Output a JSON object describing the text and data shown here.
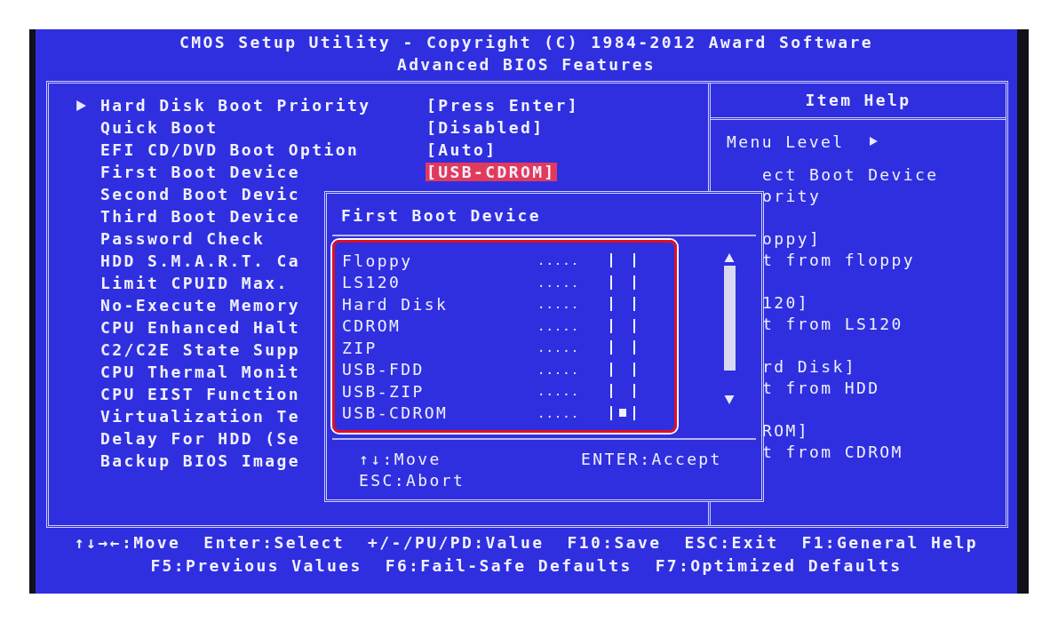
{
  "header": {
    "title": "CMOS Setup Utility - Copyright (C) 1984-2012 Award Software",
    "subtitle": "Advanced BIOS Features"
  },
  "items": [
    {
      "label": "Hard Disk Boot Priority",
      "submenu": true,
      "value": "[Press Enter]",
      "selected": false
    },
    {
      "label": "Quick Boot",
      "submenu": false,
      "value": "[Disabled]",
      "selected": false
    },
    {
      "label": "EFI CD/DVD Boot Option",
      "submenu": false,
      "value": "[Auto]",
      "selected": false
    },
    {
      "label": "First Boot Device",
      "submenu": false,
      "value": "[USB-CDROM]",
      "selected": true
    },
    {
      "label": "Second Boot Devic",
      "submenu": false,
      "selected": false
    },
    {
      "label": "Third Boot Device",
      "submenu": false,
      "selected": false
    },
    {
      "label": "Password Check",
      "submenu": false,
      "selected": false
    },
    {
      "label": "HDD S.M.A.R.T. Ca",
      "submenu": false,
      "selected": false
    },
    {
      "label": "Limit CPUID Max.",
      "submenu": false,
      "selected": false
    },
    {
      "label": "No-Execute Memory",
      "submenu": false,
      "selected": false
    },
    {
      "label": "CPU Enhanced Halt",
      "submenu": false,
      "selected": false
    },
    {
      "label": "C2/C2E State Supp",
      "submenu": false,
      "selected": false
    },
    {
      "label": "CPU Thermal Monit",
      "submenu": false,
      "selected": false
    },
    {
      "label": "CPU EIST Function",
      "submenu": false,
      "selected": false
    },
    {
      "label": "Virtualization Te",
      "submenu": false,
      "selected": false
    },
    {
      "label": "Delay For HDD (Se",
      "submenu": false,
      "selected": false
    },
    {
      "label": "Backup BIOS Image",
      "submenu": false,
      "selected": false
    }
  ],
  "help": {
    "title": "Item Help",
    "menu_level": "Menu Level",
    "blocks": [
      [
        "ect Boot Device",
        "ority"
      ],
      [
        "oppy]",
        "t from floppy"
      ],
      [
        "120]",
        "t from LS120"
      ],
      [
        "rd Disk]",
        "t from HDD"
      ],
      [
        "ROM]",
        "t from CDROM"
      ]
    ]
  },
  "popup": {
    "title": "First Boot Device",
    "leader": ".....",
    "options": [
      {
        "label": "Floppy",
        "selected": false
      },
      {
        "label": "LS120",
        "selected": false
      },
      {
        "label": "Hard Disk",
        "selected": false
      },
      {
        "label": "CDROM",
        "selected": false
      },
      {
        "label": "ZIP",
        "selected": false
      },
      {
        "label": "USB-FDD",
        "selected": false
      },
      {
        "label": "USB-ZIP",
        "selected": false
      },
      {
        "label": "USB-CDROM",
        "selected": true
      }
    ],
    "hints": [
      "↑↓:Move",
      "ENTER:Accept",
      "ESC:Abort"
    ]
  },
  "footer": {
    "keys": [
      "↑↓→←:Move",
      "Enter:Select",
      "+/-/PU/PD:Value",
      "F10:Save",
      "ESC:Exit",
      "F1:General Help",
      "F5:Previous Values",
      "F6:Fail-Safe Defaults",
      "F7:Optimized Defaults"
    ]
  }
}
